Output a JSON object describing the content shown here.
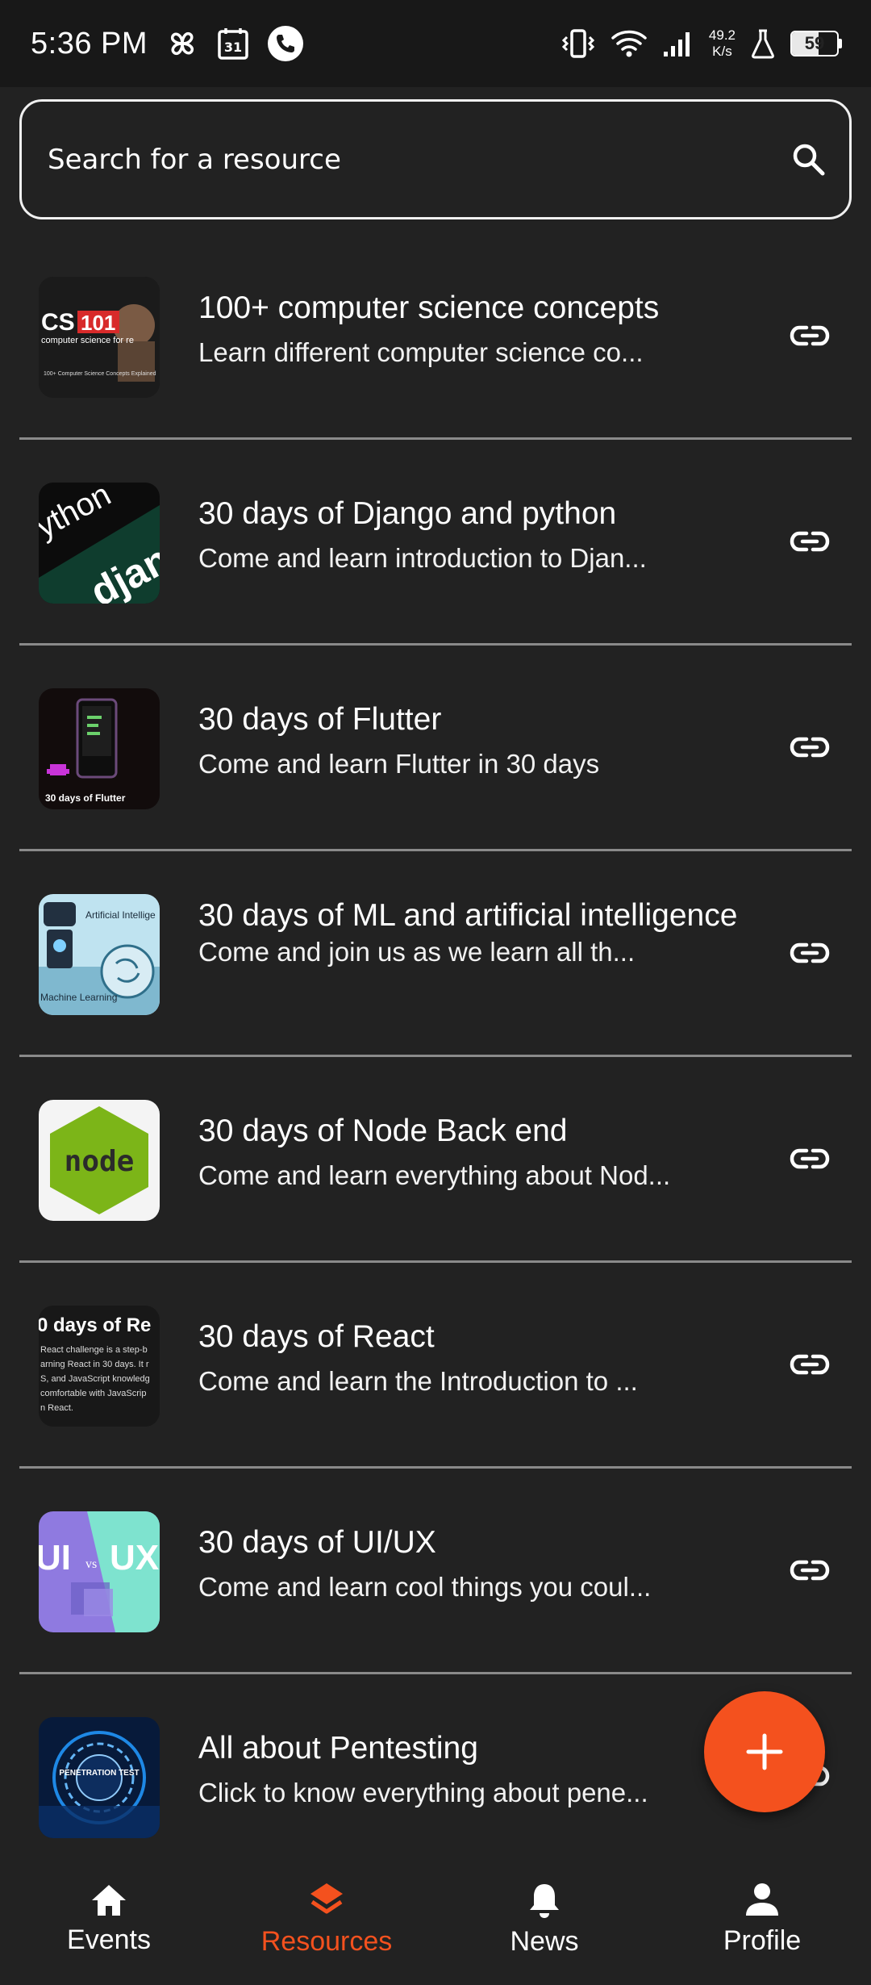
{
  "status_bar": {
    "time": "5:36 PM",
    "calendar_day": "31",
    "net_speed_value": "49.2",
    "net_speed_unit": "K/s",
    "battery": "59",
    "battery_level": 0.59
  },
  "search": {
    "placeholder": "Search for a resource",
    "value": ""
  },
  "resources": [
    {
      "title": "100+ computer science concepts",
      "subtitle": "Learn different computer science co...",
      "thumb": "cs101"
    },
    {
      "title": "30 days of Django and python",
      "subtitle": "Come and learn introduction to Djan...",
      "thumb": "django"
    },
    {
      "title": "30 days of Flutter",
      "subtitle": "Come and learn Flutter in 30 days",
      "thumb": "flutter"
    },
    {
      "title": "30 days of ML and artificial intelligence",
      "subtitle": "Come and join us as we learn all th...",
      "thumb": "ml"
    },
    {
      "title": "30 days of Node Back end",
      "subtitle": "Come and learn everything about Nod...",
      "thumb": "node"
    },
    {
      "title": "30 days of React",
      "subtitle": "Come and learn the Introduction to ...",
      "thumb": "react"
    },
    {
      "title": "30 days of UI/UX",
      "subtitle": "Come and learn cool things you coul...",
      "thumb": "uiux"
    },
    {
      "title": "All about Pentesting",
      "subtitle": "Click to know everything about pene...",
      "thumb": "pentest"
    }
  ],
  "thumb_text": {
    "cs101_big": "CS",
    "cs101_num": "101",
    "cs101_sub": "computer science for re",
    "cs101_caption": "100+ Computer Science Concepts Explained",
    "django_top": "ython",
    "django_bottom": "djan",
    "flutter_caption": "30 days of Flutter",
    "ml_top": "Artificial Intellige",
    "ml_bottom": "Machine Learning",
    "node_text": "node",
    "react_title": "0 days of Re",
    "react_body": [
      "React challenge is a step-b",
      "arning React in 30 days. It r",
      "S, and JavaScript knowledg",
      "comfortable with JavaScrip",
      "n React."
    ],
    "uiux_left": "UI",
    "uiux_vs": "vs",
    "uiux_right": "UX",
    "pentest": "PENETRATION TEST"
  },
  "bottom_nav": [
    {
      "label": "Events",
      "icon": "home-icon"
    },
    {
      "label": "Resources",
      "icon": "layers-icon"
    },
    {
      "label": "News",
      "icon": "bell-icon"
    },
    {
      "label": "Profile",
      "icon": "person-icon"
    }
  ],
  "active_nav": "Resources",
  "colors": {
    "background": "#222222",
    "accent": "#f4511e",
    "divider": "#8a8a8a",
    "text": "#ffffff"
  }
}
